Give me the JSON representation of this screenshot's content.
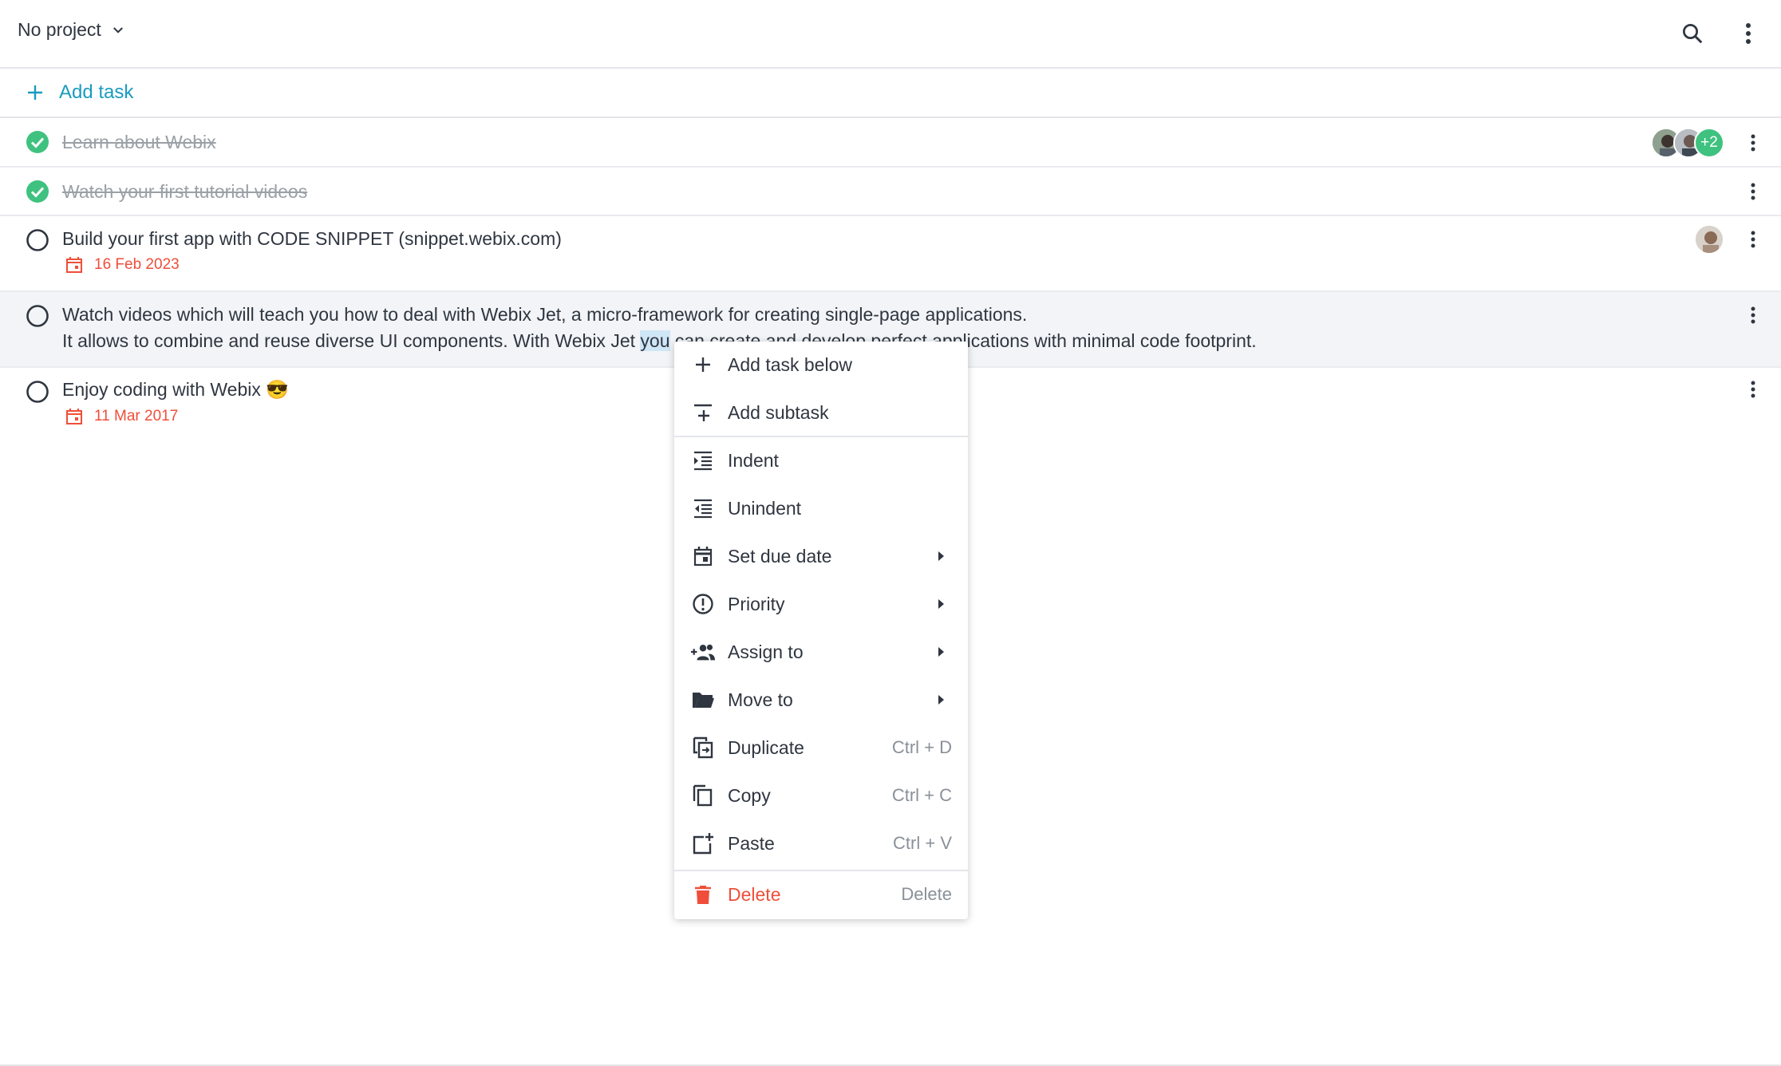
{
  "header": {
    "project_label": "No project"
  },
  "add_task": {
    "label": "Add task"
  },
  "tasks": [
    {
      "text": "Learn about Webix",
      "done": true,
      "extra_assignees": "+2"
    },
    {
      "text": "Watch your first tutorial videos",
      "done": true
    },
    {
      "text": "Build your first app with CODE SNIPPET (snippet.webix.com)",
      "done": false,
      "due": "16 Feb 2023"
    },
    {
      "text_line1": "Watch videos which will teach you how to deal with Webix Jet, a micro-framework for creating single-page applications.",
      "text_line2_a": "It allows to combine and reuse diverse UI components. With Webix Jet ",
      "text_line2_sel": "you",
      "text_line2_b": " can create and develop perfect applications with minimal code footprint.",
      "done": false
    },
    {
      "text": "Enjoy coding with Webix 😎",
      "done": false,
      "due": "11 Mar 2017"
    }
  ],
  "context_menu": {
    "items": [
      {
        "label": "Add task below",
        "icon": "plus-icon"
      },
      {
        "label": "Add subtask",
        "icon": "add-subtask-icon"
      },
      {
        "label": "Indent",
        "icon": "indent-icon"
      },
      {
        "label": "Unindent",
        "icon": "unindent-icon"
      },
      {
        "label": "Set due date",
        "icon": "calendar-icon"
      },
      {
        "label": "Priority",
        "icon": "priority-icon"
      },
      {
        "label": "Assign to",
        "icon": "assign-icon"
      },
      {
        "label": "Move to",
        "icon": "folder-icon"
      },
      {
        "label": "Duplicate",
        "icon": "duplicate-icon",
        "hotkey": "Ctrl + D"
      },
      {
        "label": "Copy",
        "icon": "copy-icon",
        "hotkey": "Ctrl + C"
      },
      {
        "label": "Paste",
        "icon": "paste-icon",
        "hotkey": "Ctrl + V"
      },
      {
        "label": "Delete",
        "icon": "trash-icon",
        "hotkey": "Delete"
      }
    ]
  },
  "colors": {
    "accent": "#1a9bbf",
    "done_green": "#3fc27f",
    "due_red": "#ef4e3a",
    "delete_red": "#ef4e3a"
  }
}
